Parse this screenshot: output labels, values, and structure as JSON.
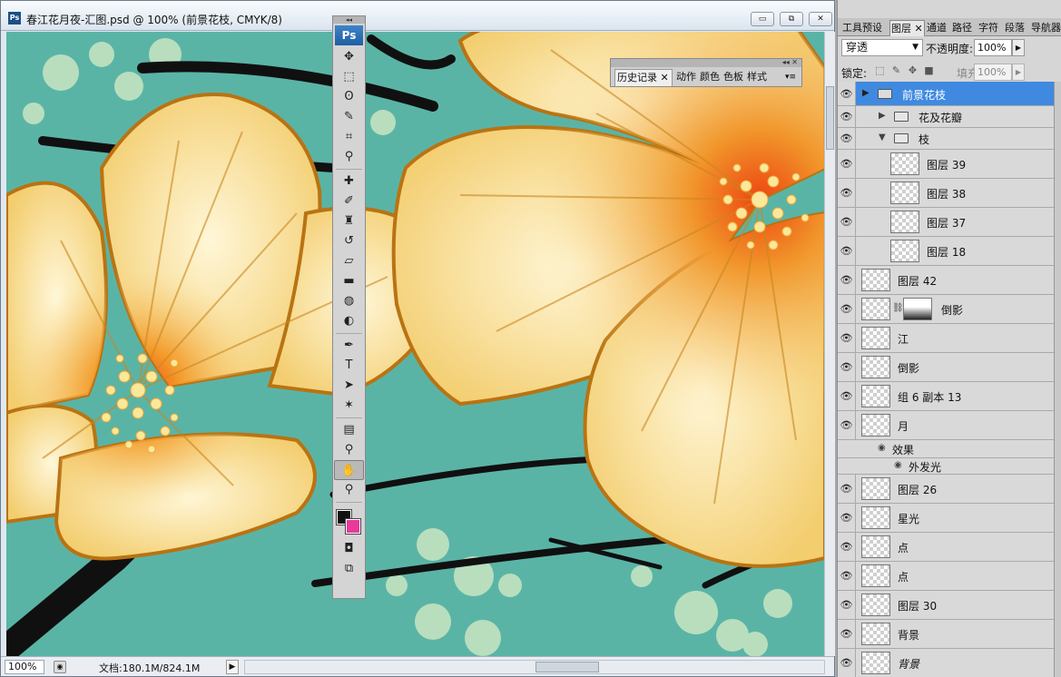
{
  "document": {
    "title": "春江花月夜-汇图.psd @ 100% (前景花枝, CMYK/8)",
    "window_buttons": {
      "minimize": "▭",
      "restore": "⧉",
      "close": "✕"
    },
    "status": {
      "zoom": "100%",
      "doc_size": "文档:180.1M/824.1M",
      "arrow": "▶"
    }
  },
  "toolbox": {
    "logo": "Ps",
    "grip": "◂◂",
    "tools": [
      {
        "icon": "move-icon",
        "glyph": "✥"
      },
      {
        "icon": "marquee-icon",
        "glyph": "⬚"
      },
      {
        "icon": "lasso-icon",
        "glyph": "ʘ"
      },
      {
        "icon": "quick-select-icon",
        "glyph": "✎"
      },
      {
        "icon": "crop-icon",
        "glyph": "⌗"
      },
      {
        "icon": "eyedropper-icon",
        "glyph": "⚲"
      },
      {
        "icon": "healing-brush-icon",
        "glyph": "✚"
      },
      {
        "icon": "brush-icon",
        "glyph": "✐"
      },
      {
        "icon": "clone-stamp-icon",
        "glyph": "♜"
      },
      {
        "icon": "history-brush-icon",
        "glyph": "↺"
      },
      {
        "icon": "eraser-icon",
        "glyph": "▱"
      },
      {
        "icon": "gradient-icon",
        "glyph": "▬"
      },
      {
        "icon": "blur-icon",
        "glyph": "◍"
      },
      {
        "icon": "dodge-icon",
        "glyph": "◐"
      },
      {
        "icon": "pen-icon",
        "glyph": "✒"
      },
      {
        "icon": "type-icon",
        "glyph": "T"
      },
      {
        "icon": "path-select-icon",
        "glyph": "➤"
      },
      {
        "icon": "custom-shape-icon",
        "glyph": "✶"
      },
      {
        "icon": "notes-icon",
        "glyph": "▤"
      },
      {
        "icon": "color-sampler-icon",
        "glyph": "⚲"
      },
      {
        "icon": "hand-icon",
        "glyph": "✋"
      },
      {
        "icon": "zoom-icon",
        "glyph": "⚲"
      }
    ],
    "quick_mask": "◘",
    "screen_mode": "⧉"
  },
  "history_panel": {
    "grip": "◂◂ ✕",
    "tabs": [
      {
        "label": "历史记录 ✕",
        "active": true
      },
      {
        "label": "动作"
      },
      {
        "label": "颜色"
      },
      {
        "label": "色板"
      },
      {
        "label": "样式"
      }
    ],
    "menu": "▾≡"
  },
  "layers_panel": {
    "tabs": [
      "工具预设",
      "图层 ✕",
      "通道",
      "路径",
      "字符",
      "段落",
      "导航器"
    ],
    "blend_mode": "穿透",
    "opacity_label": "不透明度:",
    "opacity": "100%",
    "lock_label": "锁定:",
    "fill_label": "填充:",
    "fill": "100%",
    "eye": "👁",
    "layers": [
      {
        "name": "前景花枝",
        "type": "group",
        "expanded": false,
        "selected": true
      },
      {
        "name": "花及花瓣",
        "type": "group",
        "expanded": false
      },
      {
        "name": "枝",
        "type": "group",
        "expanded": true
      },
      {
        "name": "图层 39",
        "type": "layer"
      },
      {
        "name": "图层 38",
        "type": "layer"
      },
      {
        "name": "图层 37",
        "type": "layer"
      },
      {
        "name": "图层 18",
        "type": "layer"
      },
      {
        "name": "图层 42",
        "type": "layer"
      },
      {
        "name": "倒影",
        "type": "masked"
      },
      {
        "name": "江",
        "type": "layer"
      },
      {
        "name": "倒影",
        "type": "layer"
      },
      {
        "name": "组 6 副本 13",
        "type": "layer"
      },
      {
        "name": "月",
        "type": "layer"
      },
      {
        "name": "效果",
        "type": "effect"
      },
      {
        "name": "外发光",
        "type": "effect-item"
      },
      {
        "name": "图层 26",
        "type": "layer"
      },
      {
        "name": "星光",
        "type": "layer"
      },
      {
        "name": "点",
        "type": "layer"
      },
      {
        "name": "点",
        "type": "layer"
      },
      {
        "name": "图层 30",
        "type": "layer"
      },
      {
        "name": "背景",
        "type": "layer"
      },
      {
        "name": "背景",
        "type": "background"
      }
    ]
  },
  "colors": {
    "canvas_bg": "#5ab4a6",
    "petal": "#f5d37e",
    "petal_edge": "#c07a12",
    "center": "#ee5a1a",
    "foreground": "#111111",
    "background": "#e83a9a",
    "selection": "#3f8ae0"
  }
}
